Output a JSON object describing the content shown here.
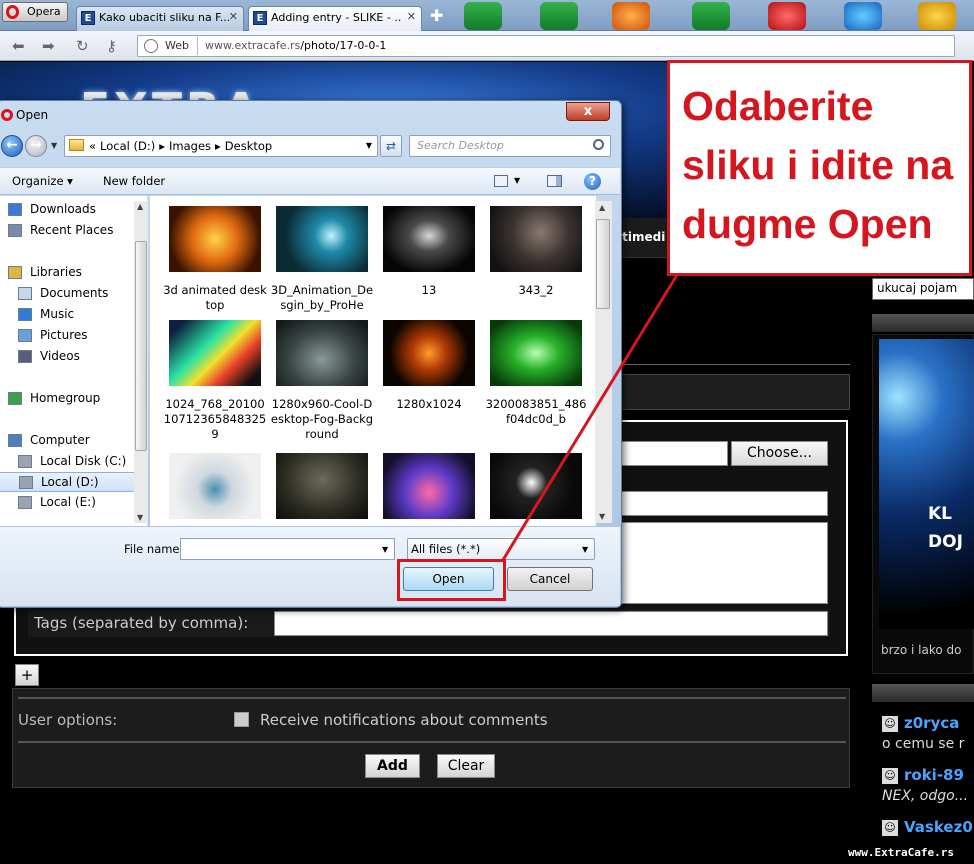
{
  "browser": {
    "menu_label": "Opera",
    "tabs": [
      {
        "title": "Kako ubaciti sliku na F...",
        "active": false
      },
      {
        "title": "Adding entry - SLIKE - ...",
        "active": true
      }
    ],
    "address_label": "Web",
    "url_host": "www.extracafe.rs",
    "url_path": "/photo/17-0-0-1"
  },
  "page": {
    "logo_text": "EXTRA",
    "menu_fragment": "ltimedi",
    "search_value": "ukucaj  pojam",
    "promo_line1": "KL",
    "promo_line2": "DOJ",
    "promo_text": "brzo i lako do",
    "choose_button": "Choose...",
    "tags_label": "Tags (separated by comma):",
    "add_row_button": "+",
    "user_options_label": "User options:",
    "notify_label": "Receive notifications about comments",
    "add_button": "Add",
    "clear_button": "Clear",
    "comments": [
      {
        "user": "z0ryca",
        "text": "o cemu se r"
      },
      {
        "user": "roki-89",
        "text": "NEX, odgo..."
      },
      {
        "user": "Vaskez0",
        "text": ""
      }
    ],
    "watermark": "www.ExtraCafe.rs"
  },
  "dialog": {
    "title": "Open",
    "close_symbol": "x",
    "breadcrumb": [
      "«",
      "Local (D:)",
      "▸",
      "Images",
      "▸",
      "Desktop"
    ],
    "search_placeholder": "Search Desktop",
    "organize_label": "Organize ▾",
    "new_folder_label": "New folder",
    "nav_items": [
      {
        "label": "Downloads",
        "icon": "downloads-icon",
        "color": "#3a7bd5"
      },
      {
        "label": "Recent Places",
        "icon": "recent-places-icon",
        "color": "#7a8ca8"
      },
      {
        "label": "Libraries",
        "icon": "libraries-icon",
        "color": "#e0b540"
      },
      {
        "label": "Documents",
        "icon": "documents-icon",
        "color": "#c7d7ea"
      },
      {
        "label": "Music",
        "icon": "music-icon",
        "color": "#2f7bd8"
      },
      {
        "label": "Pictures",
        "icon": "pictures-icon",
        "color": "#6aa0d8"
      },
      {
        "label": "Videos",
        "icon": "videos-icon",
        "color": "#56607a"
      },
      {
        "label": "Homegroup",
        "icon": "homegroup-icon",
        "color": "#3aa14a"
      },
      {
        "label": "Computer",
        "icon": "computer-icon",
        "color": "#4e7fbf"
      },
      {
        "label": "Local Disk (C:)",
        "icon": "drive-icon",
        "color": "#9aa4b0"
      },
      {
        "label": "Local (D:)",
        "icon": "drive-icon",
        "color": "#9aa4b0",
        "selected": true
      },
      {
        "label": "Local (E:)",
        "icon": "drive-icon",
        "color": "#9aa4b0"
      }
    ],
    "files": [
      {
        "name": "3d animated desktop",
        "bg": "radial-gradient(circle at 50% 50%, #ffd34a, #e06a10 40%, #3a1200 80%)"
      },
      {
        "name": "3D_Animation_Desgin_by_ProHe",
        "bg": "radial-gradient(circle at 60% 45%, #bff4ff, #1f8aa8 25%, #0a2a34 70%)"
      },
      {
        "name": "13",
        "bg": "radial-gradient(ellipse at 50% 45%, #d8d8d8, #4a4a4a 30%, #050505 75%)"
      },
      {
        "name": "343_2",
        "bg": "radial-gradient(circle at 55% 40%, #8a7a70, #3a3230 45%, #111 85%)"
      },
      {
        "name": "1024_768_20100107123658483259",
        "bg": "linear-gradient(135deg, #0d1f40 10%, #2be3a5 40%, #f2e12c 55%, #e8402a 70%, #101010 90%)"
      },
      {
        "name": "1280x960-Cool-Desktop-Fog-Background",
        "bg": "radial-gradient(ellipse at 50% 60%, #8a9a96, #3a4644 50%, #141a1a 90%)"
      },
      {
        "name": "1280x1024",
        "bg": "radial-gradient(circle at 50% 50%, #ff9c2a, #b03a05 30%, #0a0500 70%)"
      },
      {
        "name": "3200083851_486f04dc0d_b",
        "bg": "radial-gradient(ellipse at 50% 50%, #b8ffb0, #27b22a 35%, #063a08 85%)"
      },
      {
        "name": "",
        "bg": "radial-gradient(circle at 50% 55%, #4a8fb0, #cfd8de 30%, #f0f0f0 70%)"
      },
      {
        "name": "",
        "bg": "radial-gradient(ellipse at 50% 40%, #6c6a58, #2a2a22 60%, #0c0c0a)"
      },
      {
        "name": "",
        "bg": "radial-gradient(circle at 50% 60%, #ff6aa8, #5c3ac8 40%, #14102a 80%)"
      },
      {
        "name": "",
        "bg": "radial-gradient(circle at 45% 45%, #ffffff, #222 25%, #090909 70%)"
      }
    ],
    "file_name_label": "File name:",
    "file_name_value": "",
    "file_type": "All files (*.*)",
    "open_button": "Open",
    "cancel_button": "Cancel"
  },
  "annotation": {
    "text": "Odaberite sliku i idite na dugme Open",
    "color": "#d4161f"
  }
}
